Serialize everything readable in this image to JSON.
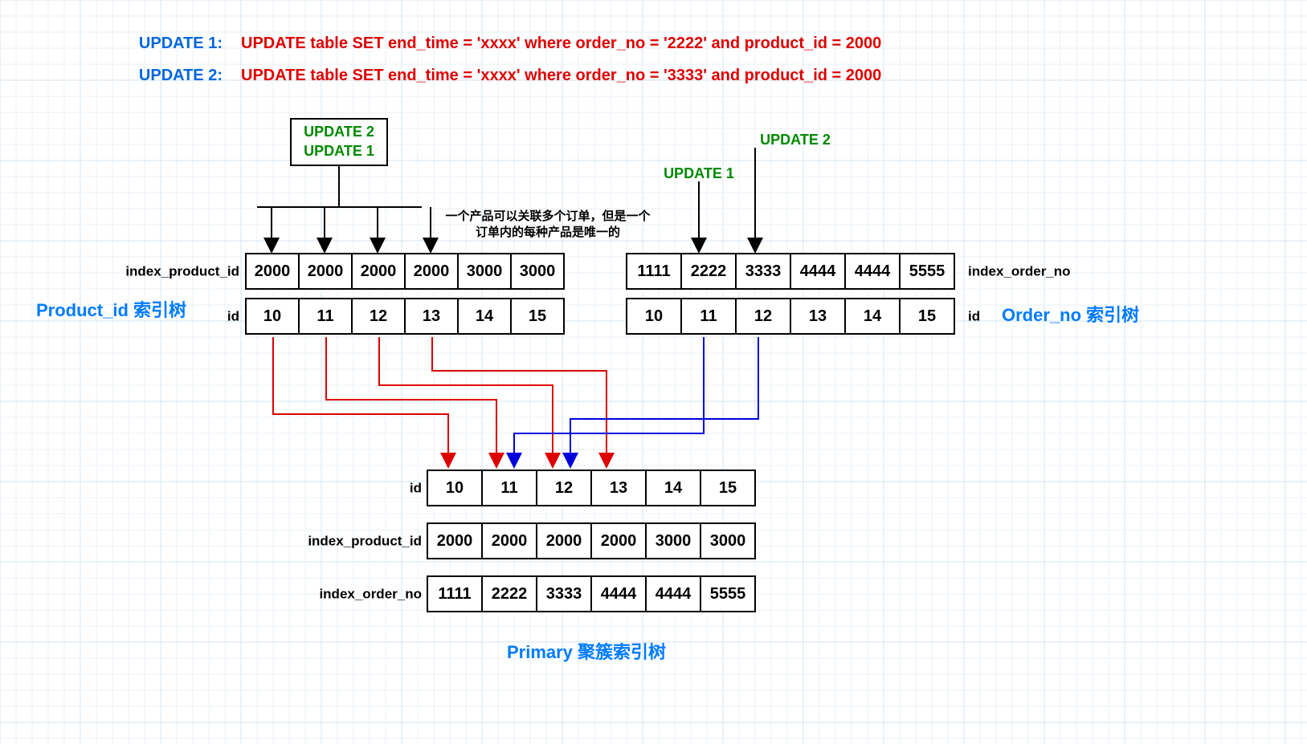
{
  "sql1_label": "UPDATE 1:",
  "sql1_text": "UPDATE table SET end_time = 'xxxx' where order_no = '2222' and product_id = 2000",
  "sql2_label": "UPDATE 2:",
  "sql2_text": "UPDATE table SET end_time = 'xxxx' where order_no = '3333' and product_id = 2000",
  "left_upd_line1": "UPDATE 2",
  "left_upd_line2": "UPDATE 1",
  "right_upd1": "UPDATE 1",
  "right_upd2": "UPDATE 2",
  "note_line1": "一个产品可以关联多个订单，但是一个",
  "note_line2": "订单内的每种产品是唯一的",
  "left_tree_title": "Product_id 索引树",
  "right_tree_title": "Order_no 索引树",
  "primary_title": "Primary 聚簇索引树",
  "label_index_product_id": "index_product_id",
  "label_id": "id",
  "label_index_order_no": "index_order_no",
  "left_table": {
    "row1": [
      "2000",
      "2000",
      "2000",
      "2000",
      "3000",
      "3000"
    ],
    "row2": [
      "10",
      "11",
      "12",
      "13",
      "14",
      "15"
    ]
  },
  "right_table": {
    "row1": [
      "1111",
      "2222",
      "3333",
      "4444",
      "4444",
      "5555"
    ],
    "row2": [
      "10",
      "11",
      "12",
      "13",
      "14",
      "15"
    ]
  },
  "primary_table": {
    "row1": [
      "10",
      "11",
      "12",
      "13",
      "14",
      "15"
    ],
    "row2": [
      "2000",
      "2000",
      "2000",
      "2000",
      "3000",
      "3000"
    ],
    "row3": [
      "1111",
      "2222",
      "3333",
      "4444",
      "4444",
      "5555"
    ]
  }
}
